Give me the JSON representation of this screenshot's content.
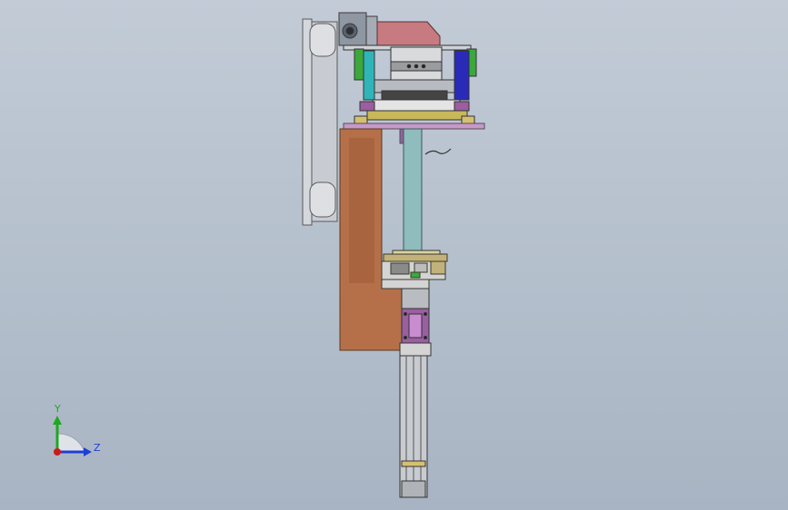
{
  "triad": {
    "y_label": "Y",
    "z_label": "Z",
    "y_color": "#1ea81e",
    "z_color": "#1f3fd6",
    "x_color": "#d01818"
  },
  "model": {
    "frame_color": "#c9ccd1",
    "bracket_color": "#b5704a",
    "shaft_color": "#8fbcbc",
    "motor_color": "#c77a80",
    "purple_color": "#9a5fa0",
    "green_color": "#3ca83c",
    "blue_color": "#2a2ab8"
  }
}
